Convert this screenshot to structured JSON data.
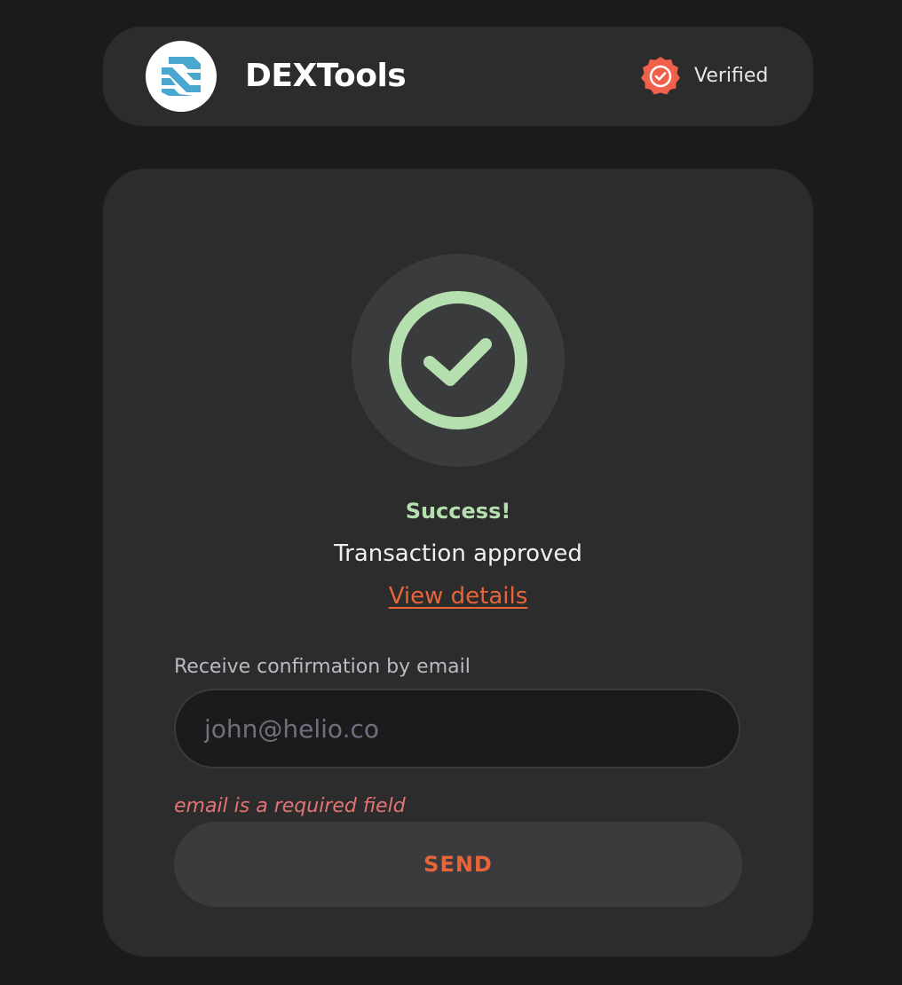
{
  "header": {
    "brand_name": "DEXTools",
    "logo_icon": "dextools-logo-icon",
    "verified_icon": "verified-badge-icon",
    "verified_label": "Verified"
  },
  "status": {
    "icon": "check-circle-icon",
    "title": "Success!",
    "message": "Transaction approved",
    "details_link": "View details"
  },
  "email_form": {
    "label": "Receive confirmation by email",
    "placeholder": "john@helio.co",
    "value": "",
    "error": "email is a required field",
    "submit_label": "SEND"
  },
  "colors": {
    "background": "#1b1b1b",
    "panel": "#2c2c2c",
    "accent": "#e8643a",
    "success": "#b5dfae",
    "error": "#e57373",
    "logo_blue": "#4aa8d0",
    "badge": "#f0604a"
  }
}
